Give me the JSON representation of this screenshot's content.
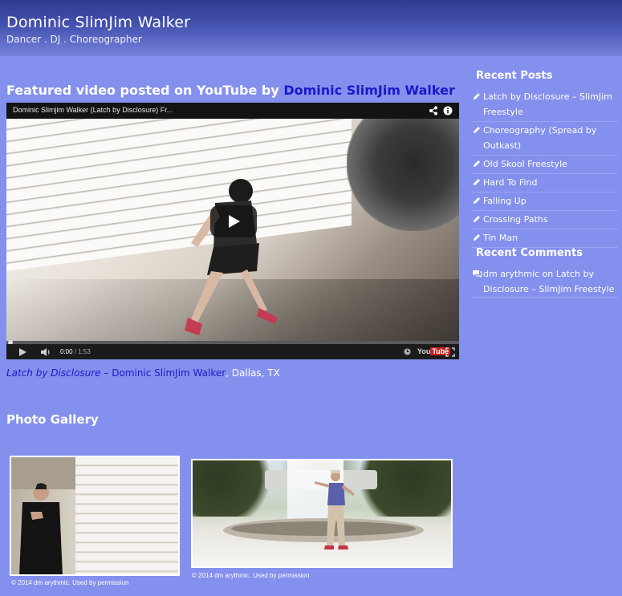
{
  "header": {
    "site_title": "Dominic SlimJim Walker",
    "tagline": "Dancer . DJ . Choreographer"
  },
  "featured": {
    "heading_prefix": "Featured video posted on YouTube by ",
    "heading_link": "Dominic SlimJim Walker"
  },
  "video": {
    "title": "Dominic Slimjim Walker (Latch by Disclosure) Fr...",
    "time_current": "0:00",
    "time_separator": " / ",
    "time_duration": "1:53",
    "youtube_label": "You",
    "youtube_badge": "Tube",
    "progress": 0
  },
  "caption": {
    "song": "Latch by Disclosure",
    "dash": " – ",
    "artist": "Dominic SlimJim Walker",
    "location": ", Dallas, TX"
  },
  "gallery": {
    "heading": "Photo Gallery",
    "photos": [
      {
        "credit": "© 2014 dm arythmic. Used by permission"
      },
      {
        "credit": "© 2014 dm arythmic. Used by permission"
      }
    ]
  },
  "sidebar": {
    "recent_posts_title": "Recent Posts",
    "posts": [
      {
        "label": "Latch by Disclosure – SlimJim Freestyle"
      },
      {
        "label": "Choreography (Spread by Outkast)"
      },
      {
        "label": "Old Skool Freestyle"
      },
      {
        "label": "Hard To Find"
      },
      {
        "label": "Falling Up"
      },
      {
        "label": "Crossing Paths"
      },
      {
        "label": "Tin Man"
      }
    ],
    "recent_comments_title": "Recent Comments",
    "comment": {
      "author": "dm arythmic",
      "on": " on ",
      "post": "Latch by Disclosure – SlimJim Freestyle"
    }
  },
  "icons": {
    "post": "pencil-icon",
    "comment": "comment-bubble-icon",
    "share": "share-icon",
    "info": "info-icon",
    "play": "play-icon",
    "volume": "volume-icon",
    "fullscreen": "fullscreen-icon",
    "clock": "watch-later-icon"
  },
  "colors": {
    "background": "#8490ee",
    "header_dark": "#2f3a8f",
    "link": "#1a1ac8",
    "text": "#ffffff"
  }
}
